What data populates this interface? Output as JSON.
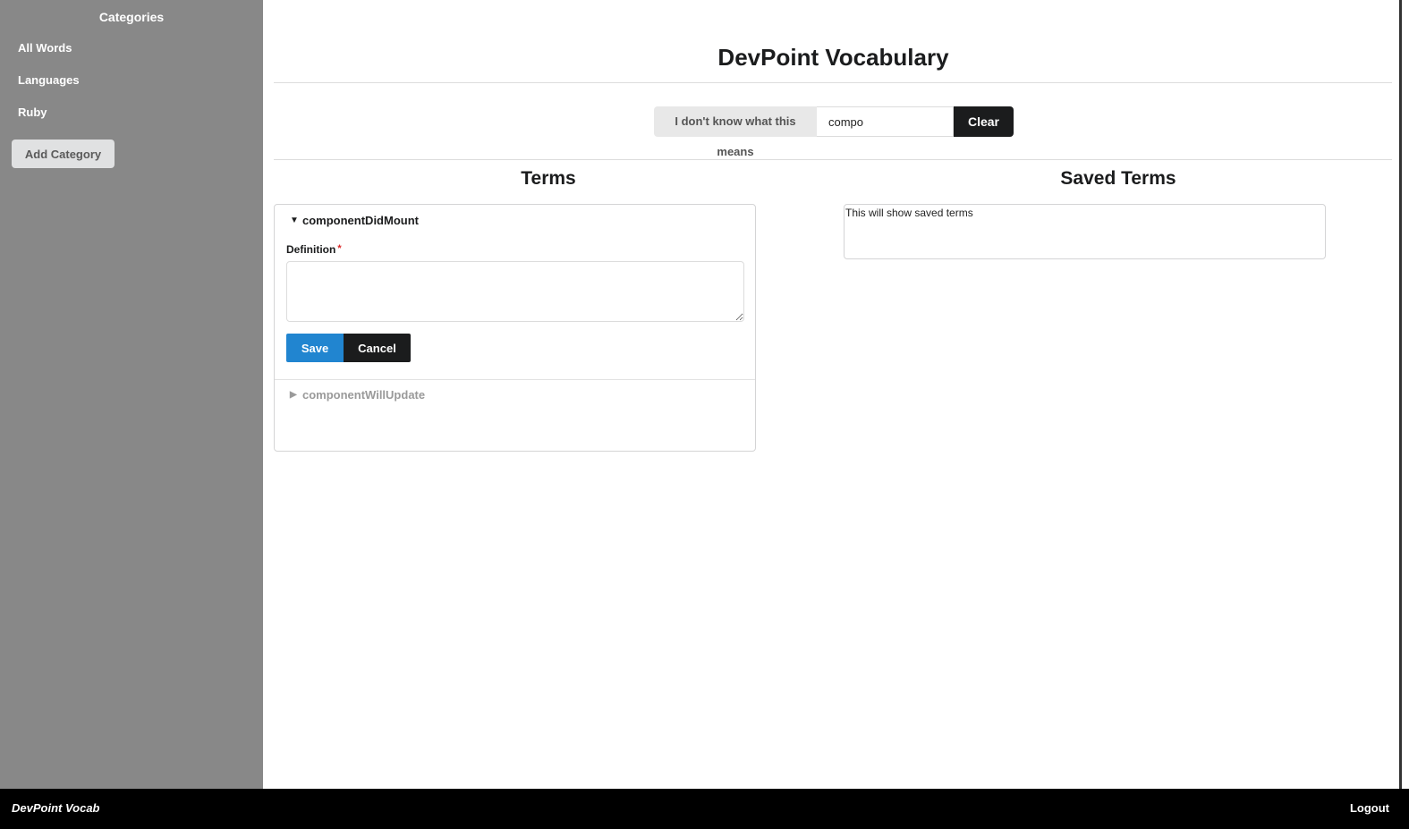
{
  "sidebar": {
    "title": "Categories",
    "items": [
      {
        "label": "All Words"
      },
      {
        "label": "Languages"
      },
      {
        "label": "Ruby"
      }
    ],
    "add_button": "Add Category"
  },
  "header": {
    "title": "DevPoint Vocabulary"
  },
  "search": {
    "label": "I don't know what this means",
    "value": "compo",
    "clear_label": "Clear"
  },
  "terms": {
    "title": "Terms",
    "items": [
      {
        "term": "componentDidMount",
        "expanded": true
      },
      {
        "term": "componentWillUpdate",
        "expanded": false
      }
    ],
    "definition_label": "Definition",
    "required_mark": "*",
    "definition_value": "",
    "save_label": "Save",
    "cancel_label": "Cancel"
  },
  "saved": {
    "title": "Saved Terms",
    "placeholder_text": "This will show saved terms"
  },
  "footer": {
    "brand": "DevPoint Vocab",
    "logout_label": "Logout"
  },
  "icons": {
    "expanded": "caret-down-icon",
    "collapsed": "caret-right-icon"
  },
  "colors": {
    "sidebar_bg": "#888888",
    "primary": "#2185d0",
    "dark": "#1b1c1d",
    "required": "#db2828"
  }
}
